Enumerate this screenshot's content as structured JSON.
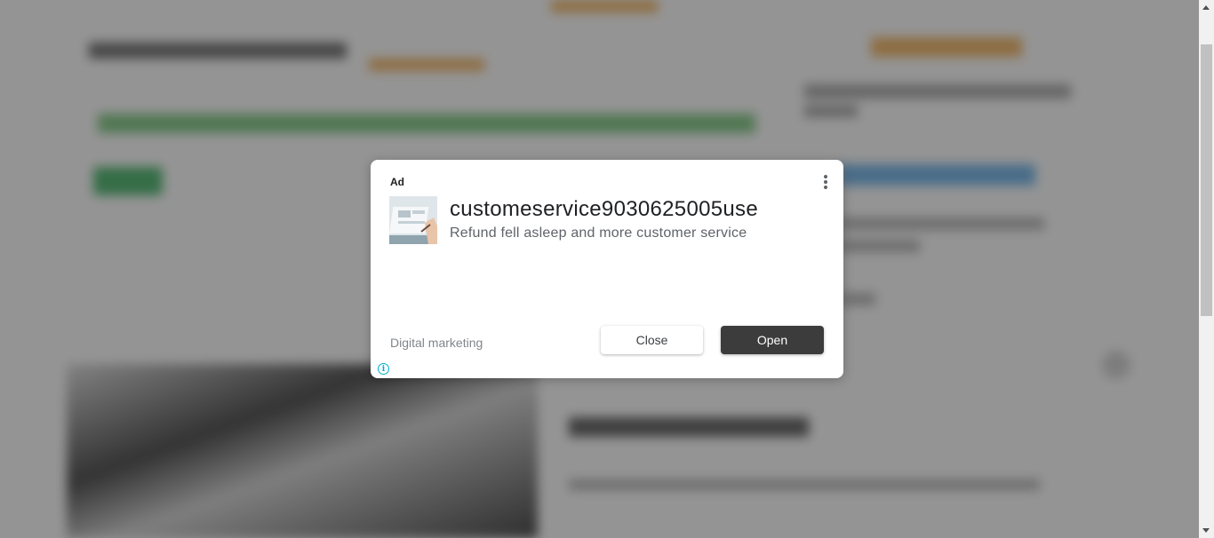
{
  "ad": {
    "label": "Ad",
    "headline": "customeservice9030625005use",
    "description": "Refund fell asleep and more customer service",
    "advertiser": "Digital marketing",
    "close_label": "Close",
    "open_label": "Open",
    "info_icon": "info-icon",
    "menu_icon": "more-vert-icon"
  },
  "colors": {
    "overlay": "#595959",
    "open_button": "#3c3c3c",
    "info_accent": "#00aecd"
  }
}
